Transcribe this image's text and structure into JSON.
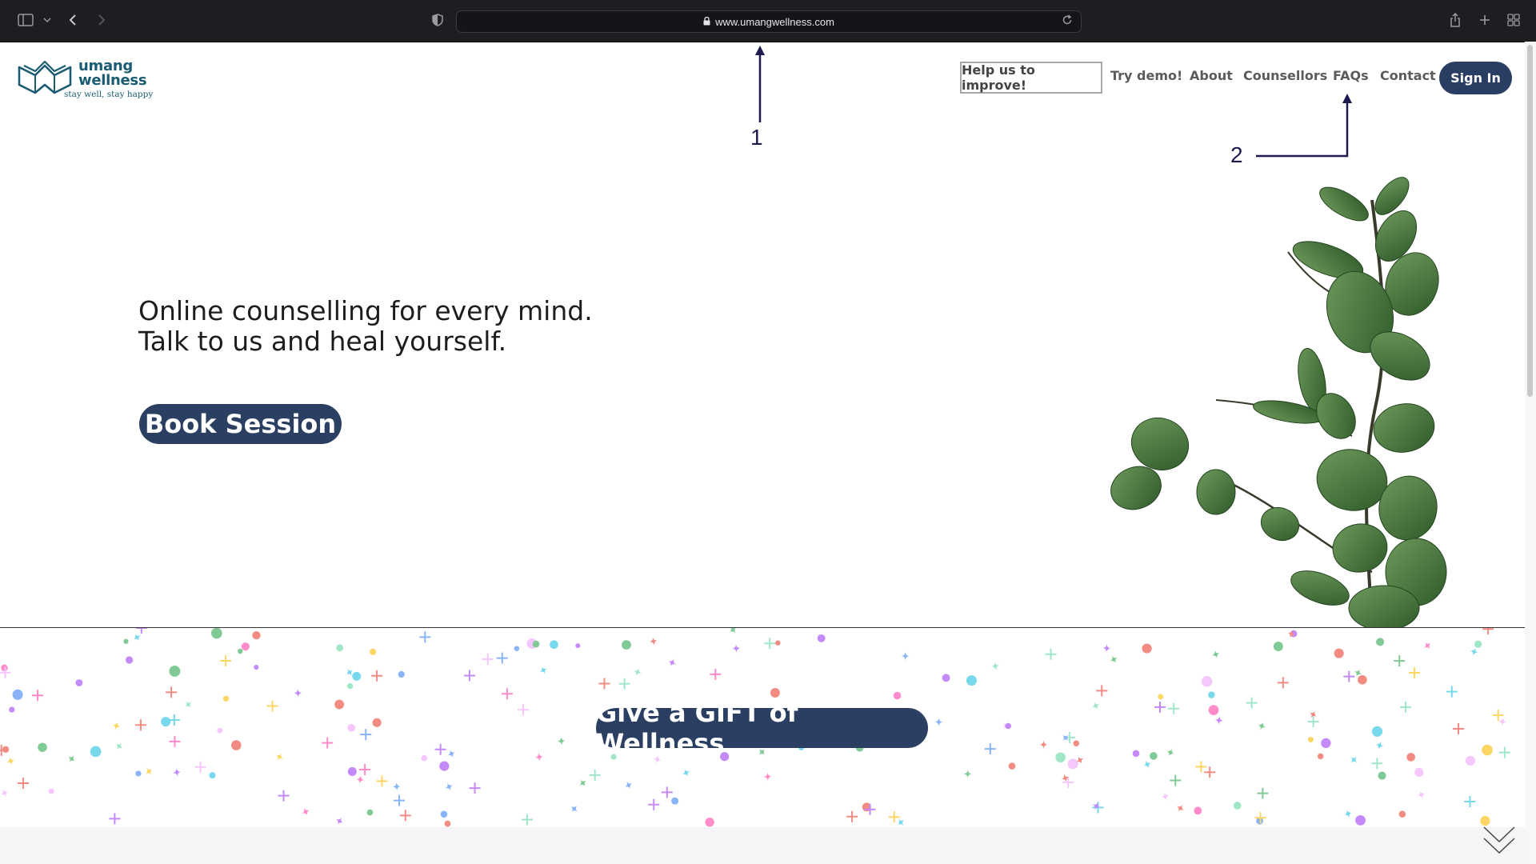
{
  "browser": {
    "url": "www.umangwellness.com"
  },
  "site": {
    "logo": {
      "brand_line1": "umang",
      "brand_line2": "wellness",
      "tagline": "stay well, stay happy"
    },
    "nav": {
      "help": "Help us to improve!",
      "demo": "Try demo!",
      "about": "About",
      "counsellors": "Counsellors",
      "faqs": "FAQs",
      "contact": "Contact",
      "signin": "Sign In"
    },
    "hero": {
      "line1": "Online counselling for every mind.",
      "line2": "Talk to us and heal yourself.",
      "cta": "Book Session"
    },
    "gift": {
      "cta": "Give a GIFT of Wellness"
    }
  },
  "annotations": {
    "label1": "1",
    "label2": "2",
    "color": "#1c1a4f"
  },
  "colors": {
    "primary": "#2b3f62",
    "brand": "#1a5c72",
    "chrome_bg": "#1e1d22"
  },
  "icons": [
    "sidebar-icon",
    "chevron-down-icon",
    "back-icon",
    "forward-icon",
    "shield-icon",
    "lock-icon",
    "reload-icon",
    "share-icon",
    "new-tab-icon",
    "tabs-overview-icon",
    "scroll-down-icon"
  ]
}
